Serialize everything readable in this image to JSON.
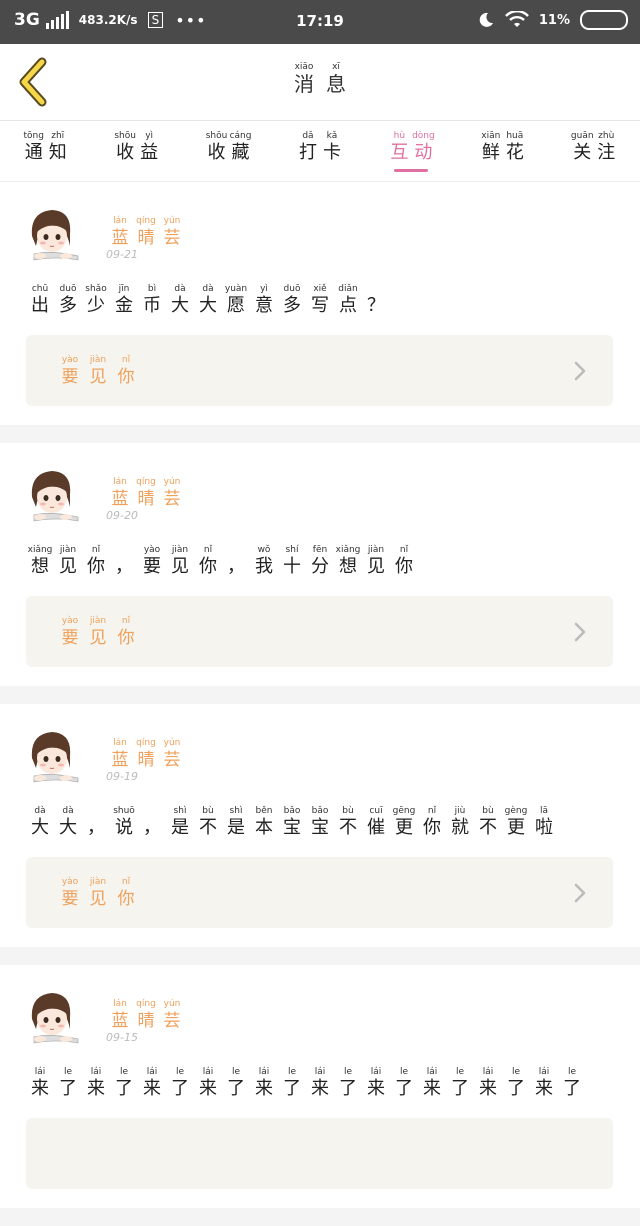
{
  "status_bar": {
    "network": "3G",
    "speed": "483.2K/s",
    "s_badge": "S",
    "dots": "•••",
    "time": "17:19",
    "battery_text": "11%"
  },
  "header": {
    "title": [
      {
        "py": "xiāo",
        "hz": "消"
      },
      {
        "py": "xī",
        "hz": "息"
      }
    ]
  },
  "tabs": [
    {
      "chars": [
        {
          "py": "tōng",
          "hz": "通"
        },
        {
          "py": "zhī",
          "hz": "知"
        }
      ],
      "active": false
    },
    {
      "chars": [
        {
          "py": "shōu",
          "hz": "收"
        },
        {
          "py": "yì",
          "hz": "益"
        }
      ],
      "active": false
    },
    {
      "chars": [
        {
          "py": "shōu",
          "hz": "收"
        },
        {
          "py": "cáng",
          "hz": "藏"
        }
      ],
      "active": false
    },
    {
      "chars": [
        {
          "py": "dǎ",
          "hz": "打"
        },
        {
          "py": "kǎ",
          "hz": "卡"
        }
      ],
      "active": false
    },
    {
      "chars": [
        {
          "py": "hù",
          "hz": "互"
        },
        {
          "py": "dòng",
          "hz": "动"
        }
      ],
      "active": true
    },
    {
      "chars": [
        {
          "py": "xiān",
          "hz": "鲜"
        },
        {
          "py": "huā",
          "hz": "花"
        }
      ],
      "active": false
    },
    {
      "chars": [
        {
          "py": "guān",
          "hz": "关"
        },
        {
          "py": "zhù",
          "hz": "注"
        }
      ],
      "active": false
    }
  ],
  "colors": {
    "accent": "#e070a0",
    "orange": "#f0a05a",
    "quote_bg": "#f5f4ee"
  },
  "feed": [
    {
      "name": [
        {
          "py": "lán",
          "hz": "蓝"
        },
        {
          "py": "qíng",
          "hz": "晴"
        },
        {
          "py": "yún",
          "hz": "芸"
        }
      ],
      "date": "09-21",
      "message": [
        {
          "py": "chū",
          "hz": "出"
        },
        {
          "py": "duō",
          "hz": "多"
        },
        {
          "py": "shǎo",
          "hz": "少"
        },
        {
          "py": "jīn",
          "hz": "金"
        },
        {
          "py": "bì",
          "hz": "币"
        },
        {
          "py": "dà",
          "hz": "大"
        },
        {
          "py": "dà",
          "hz": "大"
        },
        {
          "py": "yuàn",
          "hz": "愿"
        },
        {
          "py": "yì",
          "hz": "意"
        },
        {
          "py": "duō",
          "hz": "多"
        },
        {
          "py": "xiě",
          "hz": "写"
        },
        {
          "py": "diǎn",
          "hz": "点"
        },
        {
          "py": "",
          "hz": "？"
        }
      ],
      "quote": [
        {
          "py": "yào",
          "hz": "要"
        },
        {
          "py": "jiàn",
          "hz": "见"
        },
        {
          "py": "nǐ",
          "hz": "你"
        }
      ]
    },
    {
      "name": [
        {
          "py": "lán",
          "hz": "蓝"
        },
        {
          "py": "qíng",
          "hz": "晴"
        },
        {
          "py": "yún",
          "hz": "芸"
        }
      ],
      "date": "09-20",
      "message": [
        {
          "py": "xiǎng",
          "hz": "想"
        },
        {
          "py": "jiàn",
          "hz": "见"
        },
        {
          "py": "nǐ",
          "hz": "你"
        },
        {
          "py": "",
          "hz": "，"
        },
        {
          "py": "yào",
          "hz": "要"
        },
        {
          "py": "jiàn",
          "hz": "见"
        },
        {
          "py": "nǐ",
          "hz": "你"
        },
        {
          "py": "",
          "hz": "，"
        },
        {
          "py": "wǒ",
          "hz": "我"
        },
        {
          "py": "shí",
          "hz": "十"
        },
        {
          "py": "fēn",
          "hz": "分"
        },
        {
          "py": "xiǎng",
          "hz": "想"
        },
        {
          "py": "jiàn",
          "hz": "见"
        },
        {
          "py": "nǐ",
          "hz": "你"
        }
      ],
      "quote": [
        {
          "py": "yào",
          "hz": "要"
        },
        {
          "py": "jiàn",
          "hz": "见"
        },
        {
          "py": "nǐ",
          "hz": "你"
        }
      ]
    },
    {
      "name": [
        {
          "py": "lán",
          "hz": "蓝"
        },
        {
          "py": "qíng",
          "hz": "晴"
        },
        {
          "py": "yún",
          "hz": "芸"
        }
      ],
      "date": "09-19",
      "message": [
        {
          "py": "dà",
          "hz": "大"
        },
        {
          "py": "dà",
          "hz": "大"
        },
        {
          "py": "",
          "hz": "，"
        },
        {
          "py": "shuō",
          "hz": "说"
        },
        {
          "py": "",
          "hz": "，"
        },
        {
          "py": "shì",
          "hz": "是"
        },
        {
          "py": "bù",
          "hz": "不"
        },
        {
          "py": "shì",
          "hz": "是"
        },
        {
          "py": "běn",
          "hz": "本"
        },
        {
          "py": "bǎo",
          "hz": "宝"
        },
        {
          "py": "bǎo",
          "hz": "宝"
        },
        {
          "py": "bù",
          "hz": "不"
        },
        {
          "py": "cuī",
          "hz": "催"
        },
        {
          "py": "gēng",
          "hz": "更"
        },
        {
          "py": "nǐ",
          "hz": "你"
        },
        {
          "py": "jiù",
          "hz": "就"
        },
        {
          "py": "bù",
          "hz": "不"
        },
        {
          "py": "gèng",
          "hz": "更"
        },
        {
          "py": "lā",
          "hz": "啦"
        }
      ],
      "quote": [
        {
          "py": "yào",
          "hz": "要"
        },
        {
          "py": "jiàn",
          "hz": "见"
        },
        {
          "py": "nǐ",
          "hz": "你"
        }
      ]
    },
    {
      "name": [
        {
          "py": "lán",
          "hz": "蓝"
        },
        {
          "py": "qíng",
          "hz": "晴"
        },
        {
          "py": "yún",
          "hz": "芸"
        }
      ],
      "date": "09-15",
      "message": [
        {
          "py": "lái",
          "hz": "来"
        },
        {
          "py": "le",
          "hz": "了"
        },
        {
          "py": "lái",
          "hz": "来"
        },
        {
          "py": "le",
          "hz": "了"
        },
        {
          "py": "lái",
          "hz": "来"
        },
        {
          "py": "le",
          "hz": "了"
        },
        {
          "py": "lái",
          "hz": "来"
        },
        {
          "py": "le",
          "hz": "了"
        },
        {
          "py": "lái",
          "hz": "来"
        },
        {
          "py": "le",
          "hz": "了"
        },
        {
          "py": "lái",
          "hz": "来"
        },
        {
          "py": "le",
          "hz": "了"
        },
        {
          "py": "lái",
          "hz": "来"
        },
        {
          "py": "le",
          "hz": "了"
        },
        {
          "py": "lái",
          "hz": "来"
        },
        {
          "py": "le",
          "hz": "了"
        },
        {
          "py": "lái",
          "hz": "来"
        },
        {
          "py": "le",
          "hz": "了"
        },
        {
          "py": "lái",
          "hz": "来"
        },
        {
          "py": "le",
          "hz": "了"
        }
      ],
      "quote": []
    }
  ]
}
